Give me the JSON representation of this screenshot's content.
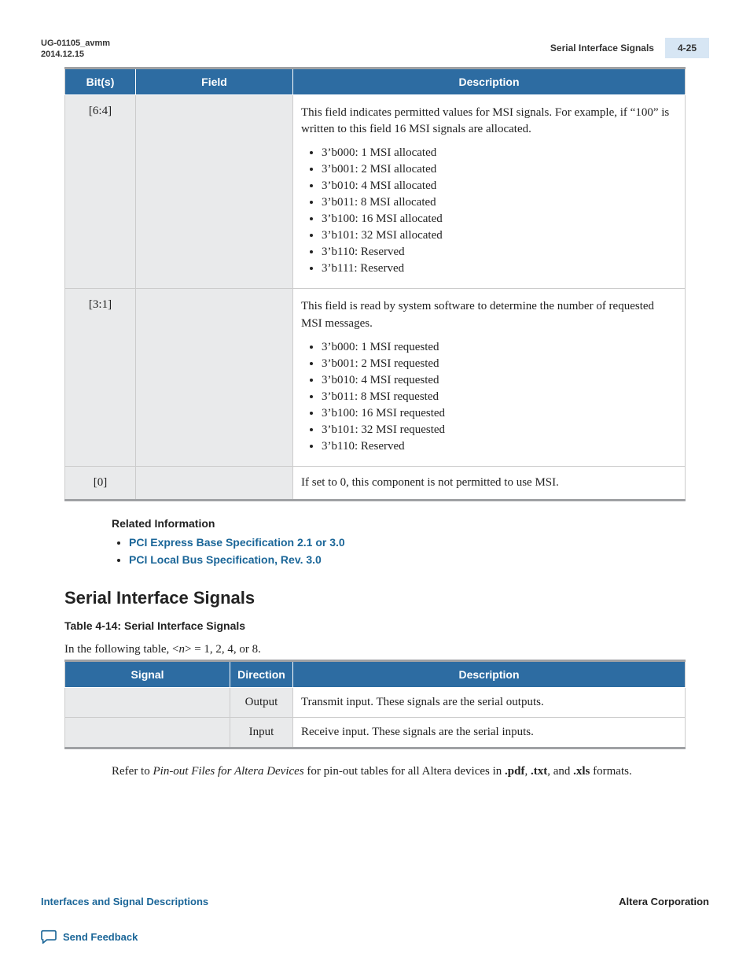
{
  "header": {
    "doc_id": "UG-01105_avmm",
    "date": "2014.12.15",
    "right_title": "Serial Interface Signals",
    "page_number": "4-25"
  },
  "bits_table": {
    "headers": [
      "Bit(s)",
      "Field",
      "Description"
    ],
    "rows": [
      {
        "bits": "[6:4]",
        "field": "",
        "desc_intro": "This field indicates permitted values for MSI signals. For example, if “100” is written to this field 16 MSI signals are allocated.",
        "items": [
          "3’b000: 1 MSI allocated",
          "3’b001: 2 MSI allocated",
          "3’b010: 4 MSI allocated",
          "3’b011: 8 MSI allocated",
          "3’b100: 16 MSI allocated",
          "3’b101: 32 MSI allocated",
          "3’b110: Reserved",
          "3’b111: Reserved"
        ]
      },
      {
        "bits": "[3:1]",
        "field": "",
        "desc_intro": "This field is read by system software to determine the number of requested MSI messages.",
        "items": [
          "3’b000: 1 MSI requested",
          "3’b001: 2 MSI requested",
          "3’b010: 4 MSI requested",
          "3’b011: 8 MSI requested",
          "3’b100: 16 MSI requested",
          "3’b101: 32 MSI requested",
          "3’b110: Reserved"
        ]
      },
      {
        "bits": "[0]",
        "field": "",
        "desc_intro": "If set to 0, this component is not permitted to use MSI.",
        "items": []
      }
    ]
  },
  "related": {
    "title": "Related Information",
    "links": [
      "PCI Express Base Specification 2.1 or 3.0",
      "PCI Local Bus Specification, Rev. 3.0"
    ]
  },
  "section": {
    "title": "Serial Interface Signals",
    "table_caption": "Table 4-14: Serial Interface Signals",
    "intro_pre": "In the following table, <",
    "intro_italic": "n",
    "intro_post": "> = 1, 2, 4, or 8."
  },
  "signals_table": {
    "headers": [
      "Signal",
      "Direction",
      "Description"
    ],
    "rows": [
      {
        "signal": "",
        "direction": "Output",
        "description": "Transmit input. These signals are the serial outputs."
      },
      {
        "signal": "",
        "direction": "Input",
        "description": "Receive input. These signals are the serial inputs."
      }
    ]
  },
  "post_table": {
    "pre": "Refer to ",
    "italic": "Pin-out Files for Altera Devices",
    "mid": " for pin-out tables for all Altera devices in ",
    "b1": ".pdf",
    "c1": ", ",
    "b2": ".txt",
    "c2": ", and ",
    "b3": ".xls",
    "end": " formats."
  },
  "footer": {
    "left_link": "Interfaces and Signal Descriptions",
    "right_text": "Altera Corporation",
    "feedback": "Send Feedback"
  }
}
